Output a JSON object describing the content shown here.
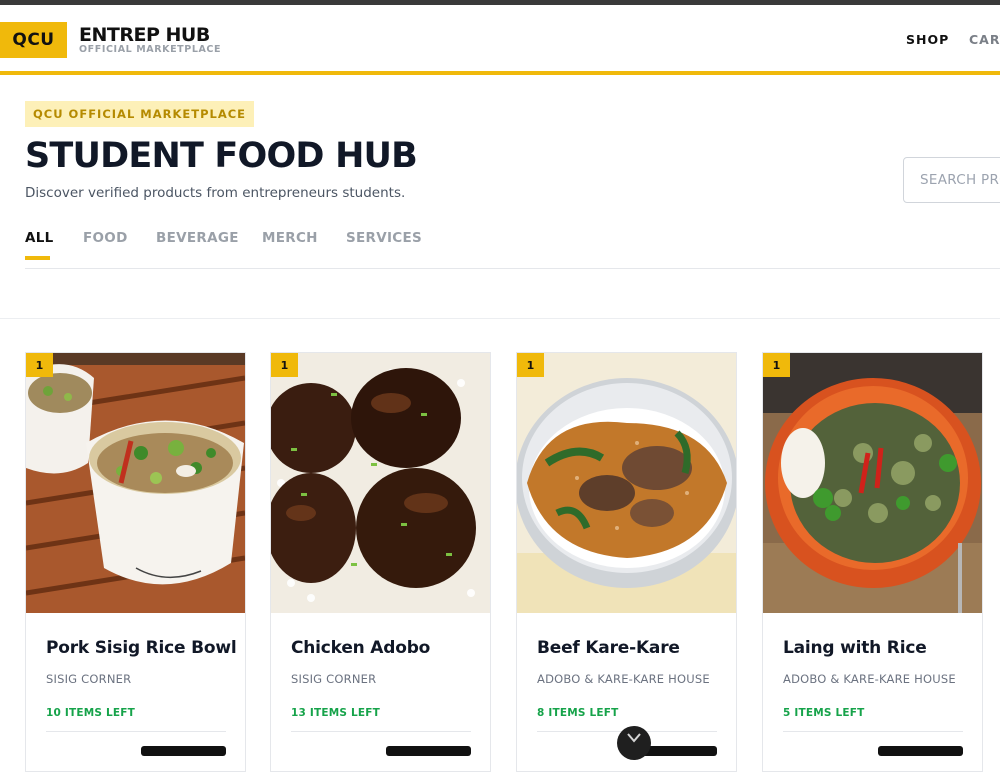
{
  "header": {
    "logo_text": "QCU",
    "brand_title": "ENTREP HUB",
    "brand_subtitle": "OFFICIAL MARKETPLACE",
    "nav": {
      "shop": "SHOP",
      "cart": "CART"
    }
  },
  "hero": {
    "badge": "QCU OFFICIAL MARKETPLACE",
    "title": "STUDENT FOOD HUB",
    "subtitle": "Discover verified products from entrepreneurs students.",
    "search_placeholder": "SEARCH PRODUCTS"
  },
  "tabs": [
    {
      "label": "ALL",
      "active": true
    },
    {
      "label": "FOOD",
      "active": false
    },
    {
      "label": "BEVERAGE",
      "active": false
    },
    {
      "label": "MERCH",
      "active": false
    },
    {
      "label": "SERVICES",
      "active": false
    }
  ],
  "products": [
    {
      "qty": "1",
      "name": "Pork Sisig Rice Bowl",
      "shop": "SISIG CORNER",
      "stock": "10 ITEMS LEFT"
    },
    {
      "qty": "1",
      "name": "Chicken Adobo",
      "shop": "SISIG CORNER",
      "stock": "13 ITEMS LEFT"
    },
    {
      "qty": "1",
      "name": "Beef Kare-Kare",
      "shop": "ADOBO & KARE-KARE HOUSE",
      "stock": "8 ITEMS LEFT"
    },
    {
      "qty": "1",
      "name": "Laing with Rice",
      "shop": "ADOBO & KARE-KARE HOUSE",
      "stock": "5 ITEMS LEFT"
    }
  ],
  "colors": {
    "accent": "#f0b90b",
    "stock_green": "#16a34a",
    "text_dark": "#111827"
  },
  "icons": {
    "scroll_down": "chevron-down-icon"
  }
}
